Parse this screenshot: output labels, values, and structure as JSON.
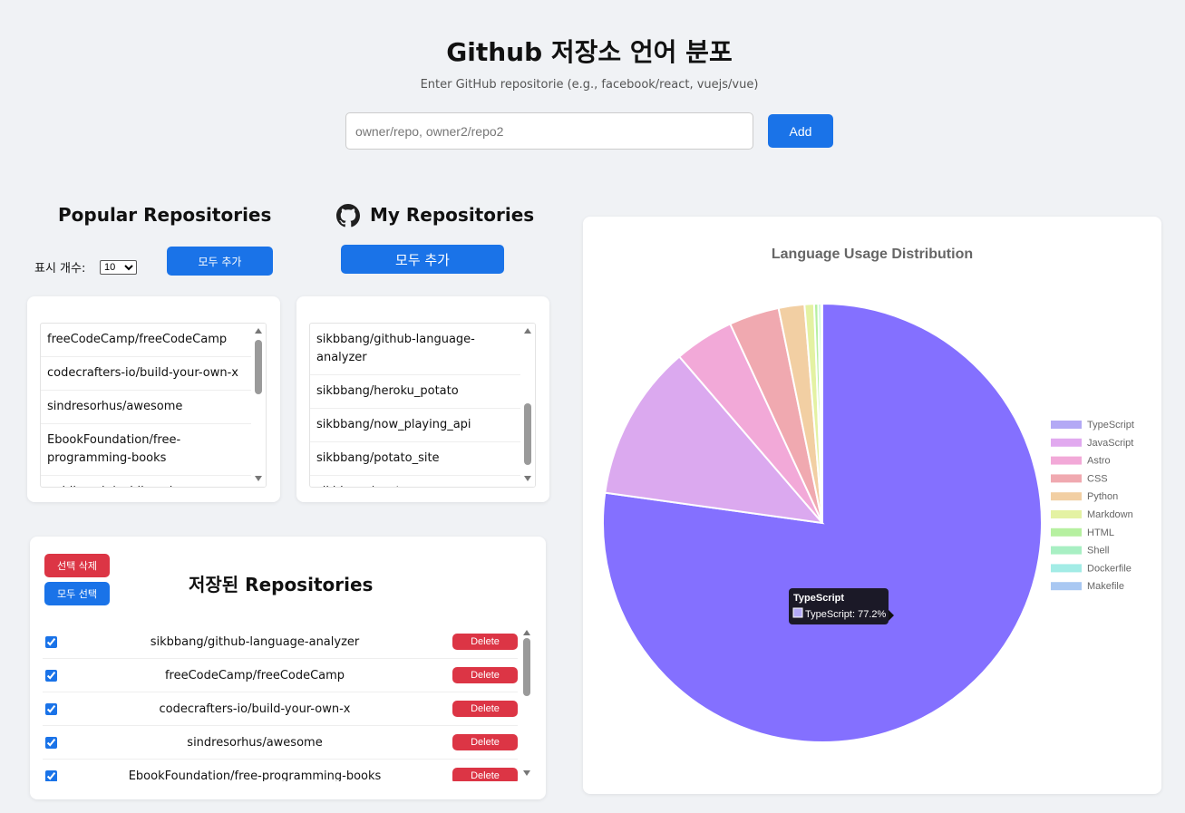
{
  "header": {
    "title": "Github 저장소 언어 분포",
    "subtitle": "Enter GitHub repositorie (e.g., facebook/react, vuejs/vue)",
    "input_placeholder": "owner/repo, owner2/repo2",
    "add_label": "Add"
  },
  "popular": {
    "title": "Popular Repositories",
    "count_label": "표시 개수:",
    "count_value": "10",
    "add_all_label": "모두 추가",
    "items": [
      "freeCodeCamp/freeCodeCamp",
      "codecrafters-io/build-your-own-x",
      "sindresorhus/awesome",
      "EbookFoundation/free-programming-books",
      "public-apis/public-apis"
    ]
  },
  "mine": {
    "title": "My Repositories",
    "add_all_label": "모두 추가",
    "items": [
      "sikbbang/github-language-analyzer",
      "sikbbang/heroku_potato",
      "sikbbang/now_playing_api",
      "sikbbang/potato_site",
      "sikbbang/pygt"
    ]
  },
  "saved": {
    "title": "저장된 Repositories",
    "delete_selected_label": "선택 삭제",
    "select_all_label": "모두 선택",
    "delete_label": "Delete",
    "items": [
      "sikbbang/github-language-analyzer",
      "freeCodeCamp/freeCodeCamp",
      "codecrafters-io/build-your-own-x",
      "sindresorhus/awesome",
      "EbookFoundation/free-programming-books"
    ]
  },
  "chart_data": {
    "type": "pie",
    "title": "Language Usage Distribution",
    "categories": [
      "TypeScript",
      "JavaScript",
      "Astro",
      "CSS",
      "Python",
      "Markdown",
      "HTML",
      "Shell",
      "Dockerfile",
      "Makefile"
    ],
    "values": [
      77.2,
      11.5,
      4.4,
      3.7,
      1.9,
      0.7,
      0.3,
      0.2,
      0.06,
      0.04
    ],
    "colors": [
      "#8470ff",
      "#dba9ef",
      "#f2a9d8",
      "#f0a9b0",
      "#f2cfa3",
      "#e4f2a3",
      "#b6f0a0",
      "#a8efc3",
      "#a3ece6",
      "#a9c8f2"
    ],
    "legend_colors": [
      "#b3a9f5",
      "#e1a9ef",
      "#f2a9d8",
      "#f0a9b0",
      "#f2cfa3",
      "#e4f2a3",
      "#b6f0a0",
      "#a8efc3",
      "#a3ece6",
      "#a9c8f2"
    ],
    "legend_position": "right",
    "tooltip": {
      "title": "TypeScript",
      "label": "TypeScript: 77.2%"
    }
  },
  "icons": {
    "github": "github-icon"
  }
}
